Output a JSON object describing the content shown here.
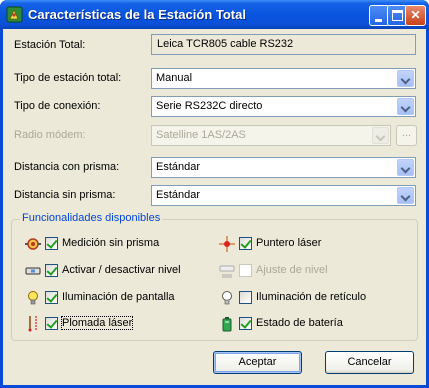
{
  "window": {
    "title": "Características de la Estación Total"
  },
  "fields": {
    "estacion_total": {
      "label": "Estación Total:",
      "value": "Leica TCR805 cable RS232"
    },
    "tipo_estacion": {
      "label": "Tipo de estación total:",
      "value": "Manual"
    },
    "tipo_conexion": {
      "label": "Tipo de conexión:",
      "value": "Serie RS232C directo"
    },
    "radio_modem": {
      "label": "Radio módem:",
      "value": "Satelline 1AS/2AS",
      "disabled": true,
      "button_label": "..."
    },
    "distancia_con_prisma": {
      "label": "Distancia con prisma:",
      "value": "Estándar"
    },
    "distancia_sin_prisma": {
      "label": "Distancia sin prisma:",
      "value": "Estándar"
    }
  },
  "features": {
    "title": "Funcionalidades disponibles",
    "items": [
      {
        "label": "Medición sin prisma",
        "checked": true,
        "disabled": false,
        "icon": "target-icon"
      },
      {
        "label": "Puntero láser",
        "checked": true,
        "disabled": false,
        "icon": "laser-pointer-icon"
      },
      {
        "label": "Activar / desactivar nivel",
        "checked": true,
        "disabled": false,
        "icon": "level-icon"
      },
      {
        "label": "Ajuste de nivel",
        "checked": false,
        "disabled": true,
        "icon": "level-adjust-icon"
      },
      {
        "label": "Iluminación de pantalla",
        "checked": true,
        "disabled": false,
        "icon": "lightbulb-icon"
      },
      {
        "label": "Iluminación de retículo",
        "checked": false,
        "disabled": false,
        "icon": "lightbulb-outline-icon"
      },
      {
        "label": "Plomada láser",
        "checked": true,
        "disabled": false,
        "icon": "plumb-laser-icon"
      },
      {
        "label": "Estado de batería",
        "checked": true,
        "disabled": false,
        "icon": "battery-icon"
      }
    ]
  },
  "buttons": {
    "accept": "Aceptar",
    "cancel": "Cancelar"
  },
  "colors": {
    "titlebar": "#0a55df",
    "face": "#ece9d8",
    "group_title": "#0046d5",
    "check": "#21a121"
  }
}
